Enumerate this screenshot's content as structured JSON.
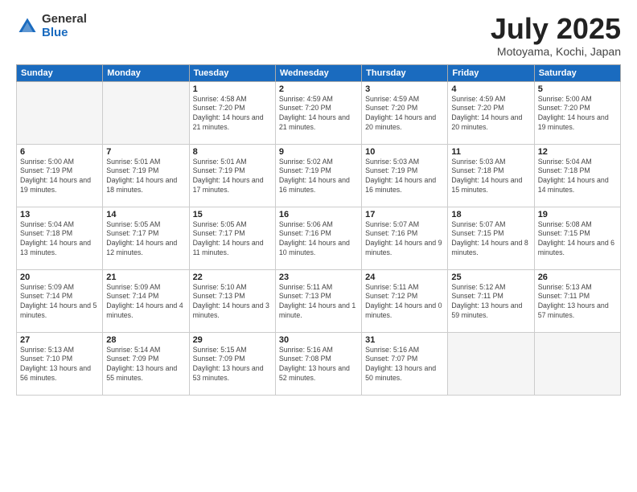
{
  "logo": {
    "general": "General",
    "blue": "Blue"
  },
  "title": "July 2025",
  "location": "Motoyama, Kochi, Japan",
  "days_of_week": [
    "Sunday",
    "Monday",
    "Tuesday",
    "Wednesday",
    "Thursday",
    "Friday",
    "Saturday"
  ],
  "weeks": [
    [
      {
        "num": "",
        "info": ""
      },
      {
        "num": "",
        "info": ""
      },
      {
        "num": "1",
        "info": "Sunrise: 4:58 AM\nSunset: 7:20 PM\nDaylight: 14 hours\nand 21 minutes."
      },
      {
        "num": "2",
        "info": "Sunrise: 4:59 AM\nSunset: 7:20 PM\nDaylight: 14 hours\nand 21 minutes."
      },
      {
        "num": "3",
        "info": "Sunrise: 4:59 AM\nSunset: 7:20 PM\nDaylight: 14 hours\nand 20 minutes."
      },
      {
        "num": "4",
        "info": "Sunrise: 4:59 AM\nSunset: 7:20 PM\nDaylight: 14 hours\nand 20 minutes."
      },
      {
        "num": "5",
        "info": "Sunrise: 5:00 AM\nSunset: 7:20 PM\nDaylight: 14 hours\nand 19 minutes."
      }
    ],
    [
      {
        "num": "6",
        "info": "Sunrise: 5:00 AM\nSunset: 7:19 PM\nDaylight: 14 hours\nand 19 minutes."
      },
      {
        "num": "7",
        "info": "Sunrise: 5:01 AM\nSunset: 7:19 PM\nDaylight: 14 hours\nand 18 minutes."
      },
      {
        "num": "8",
        "info": "Sunrise: 5:01 AM\nSunset: 7:19 PM\nDaylight: 14 hours\nand 17 minutes."
      },
      {
        "num": "9",
        "info": "Sunrise: 5:02 AM\nSunset: 7:19 PM\nDaylight: 14 hours\nand 16 minutes."
      },
      {
        "num": "10",
        "info": "Sunrise: 5:03 AM\nSunset: 7:19 PM\nDaylight: 14 hours\nand 16 minutes."
      },
      {
        "num": "11",
        "info": "Sunrise: 5:03 AM\nSunset: 7:18 PM\nDaylight: 14 hours\nand 15 minutes."
      },
      {
        "num": "12",
        "info": "Sunrise: 5:04 AM\nSunset: 7:18 PM\nDaylight: 14 hours\nand 14 minutes."
      }
    ],
    [
      {
        "num": "13",
        "info": "Sunrise: 5:04 AM\nSunset: 7:18 PM\nDaylight: 14 hours\nand 13 minutes."
      },
      {
        "num": "14",
        "info": "Sunrise: 5:05 AM\nSunset: 7:17 PM\nDaylight: 14 hours\nand 12 minutes."
      },
      {
        "num": "15",
        "info": "Sunrise: 5:05 AM\nSunset: 7:17 PM\nDaylight: 14 hours\nand 11 minutes."
      },
      {
        "num": "16",
        "info": "Sunrise: 5:06 AM\nSunset: 7:16 PM\nDaylight: 14 hours\nand 10 minutes."
      },
      {
        "num": "17",
        "info": "Sunrise: 5:07 AM\nSunset: 7:16 PM\nDaylight: 14 hours\nand 9 minutes."
      },
      {
        "num": "18",
        "info": "Sunrise: 5:07 AM\nSunset: 7:15 PM\nDaylight: 14 hours\nand 8 minutes."
      },
      {
        "num": "19",
        "info": "Sunrise: 5:08 AM\nSunset: 7:15 PM\nDaylight: 14 hours\nand 6 minutes."
      }
    ],
    [
      {
        "num": "20",
        "info": "Sunrise: 5:09 AM\nSunset: 7:14 PM\nDaylight: 14 hours\nand 5 minutes."
      },
      {
        "num": "21",
        "info": "Sunrise: 5:09 AM\nSunset: 7:14 PM\nDaylight: 14 hours\nand 4 minutes."
      },
      {
        "num": "22",
        "info": "Sunrise: 5:10 AM\nSunset: 7:13 PM\nDaylight: 14 hours\nand 3 minutes."
      },
      {
        "num": "23",
        "info": "Sunrise: 5:11 AM\nSunset: 7:13 PM\nDaylight: 14 hours\nand 1 minute."
      },
      {
        "num": "24",
        "info": "Sunrise: 5:11 AM\nSunset: 7:12 PM\nDaylight: 14 hours\nand 0 minutes."
      },
      {
        "num": "25",
        "info": "Sunrise: 5:12 AM\nSunset: 7:11 PM\nDaylight: 13 hours\nand 59 minutes."
      },
      {
        "num": "26",
        "info": "Sunrise: 5:13 AM\nSunset: 7:11 PM\nDaylight: 13 hours\nand 57 minutes."
      }
    ],
    [
      {
        "num": "27",
        "info": "Sunrise: 5:13 AM\nSunset: 7:10 PM\nDaylight: 13 hours\nand 56 minutes."
      },
      {
        "num": "28",
        "info": "Sunrise: 5:14 AM\nSunset: 7:09 PM\nDaylight: 13 hours\nand 55 minutes."
      },
      {
        "num": "29",
        "info": "Sunrise: 5:15 AM\nSunset: 7:09 PM\nDaylight: 13 hours\nand 53 minutes."
      },
      {
        "num": "30",
        "info": "Sunrise: 5:16 AM\nSunset: 7:08 PM\nDaylight: 13 hours\nand 52 minutes."
      },
      {
        "num": "31",
        "info": "Sunrise: 5:16 AM\nSunset: 7:07 PM\nDaylight: 13 hours\nand 50 minutes."
      },
      {
        "num": "",
        "info": ""
      },
      {
        "num": "",
        "info": ""
      }
    ]
  ]
}
